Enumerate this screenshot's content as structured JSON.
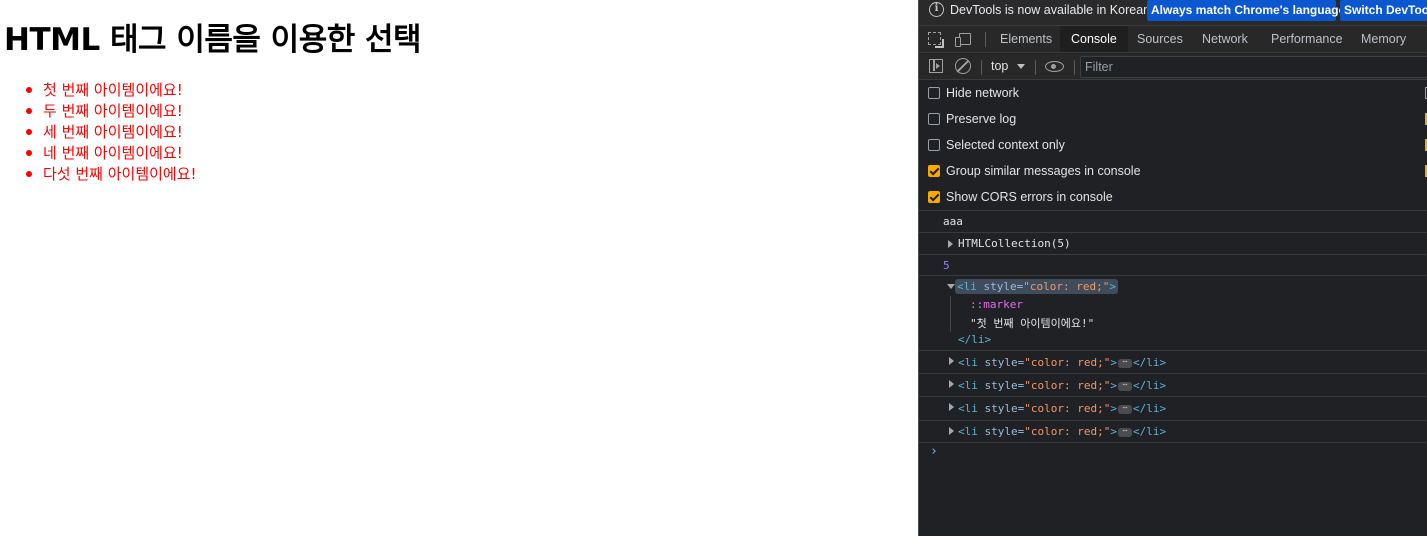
{
  "page": {
    "title": "HTML 태그 이름을 이용한 선택",
    "items": [
      "첫 번째 아이템이에요!",
      "두 번째 아이템이에요!",
      "세 번째 아이템이에요!",
      "네 번째 아이템이에요!",
      "다섯 번째 아이템이에요!"
    ],
    "item_color": "#ff0000"
  },
  "devtools": {
    "infobar": {
      "icon": "info-icon",
      "text": "DevTools is now available in Korean!",
      "match_button": "Always match Chrome's language",
      "switch_button": "Switch DevTools"
    },
    "tabs": [
      "Elements",
      "Console",
      "Sources",
      "Network",
      "Performance",
      "Memory"
    ],
    "active_tab": "Console",
    "toolbar": {
      "context": "top",
      "filter_placeholder": "Filter"
    },
    "settings": [
      {
        "label": "Hide network",
        "checked": false
      },
      {
        "label": "Preserve log",
        "checked": false
      },
      {
        "label": "Selected context only",
        "checked": false
      },
      {
        "label": "Group similar messages in console",
        "checked": true
      },
      {
        "label": "Show CORS errors in console",
        "checked": true
      }
    ],
    "messages": {
      "log_text": "aaa",
      "collection": "HTMLCollection(5)",
      "count": "5",
      "li_open_tag": "<li",
      "li_attr": "style=",
      "li_attr_value": "\"color: red;\"",
      "li_close_bracket": ">",
      "li_close_tag": "</li>",
      "marker": "::marker",
      "text_node": "\"첫 번째 아이템이에요!\"",
      "ellipsis": "⋯"
    },
    "prompt": "›",
    "accent_color": "#f9ab00",
    "button_color": "#0b57d0"
  }
}
